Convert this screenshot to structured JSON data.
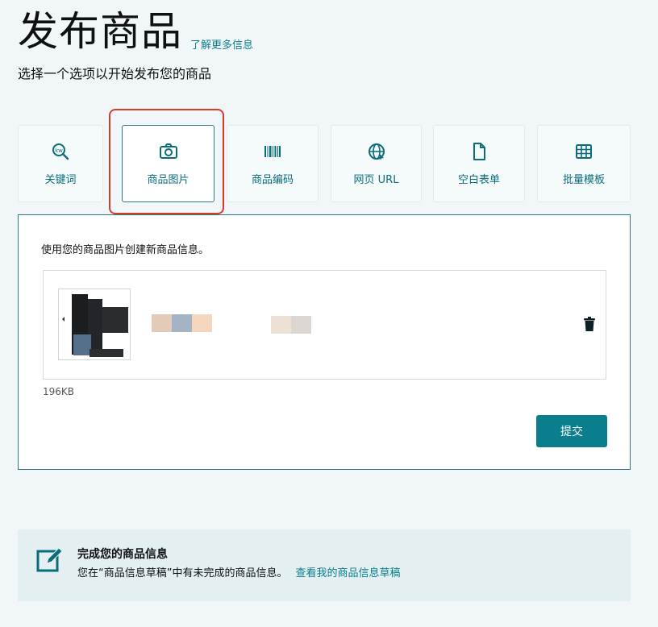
{
  "header": {
    "title": "发布商品",
    "learn_more": "了解更多信息",
    "subtitle": "选择一个选项以开始发布您的商品"
  },
  "options": [
    {
      "label": "关键词",
      "icon": "keyword-search-icon"
    },
    {
      "label": "商品图片",
      "icon": "camera-icon",
      "selected": true
    },
    {
      "label": "商品编码",
      "icon": "barcode-icon"
    },
    {
      "label": "网页 URL",
      "icon": "globe-icon"
    },
    {
      "label": "空白表单",
      "icon": "document-icon"
    },
    {
      "label": "批量模板",
      "icon": "spreadsheet-icon"
    }
  ],
  "panel": {
    "description": "使用您的商品图片创建新商品信息。",
    "file_size": "196KB",
    "submit_label": "提交"
  },
  "draft": {
    "title": "完成您的商品信息",
    "text": "您在“商品信息草稿”中有未完成的商品信息。",
    "link": "查看我的商品信息草稿"
  },
  "colors": {
    "accent": "#0a7e8c",
    "highlight": "#d93a2b",
    "background": "#f1f7f9"
  }
}
